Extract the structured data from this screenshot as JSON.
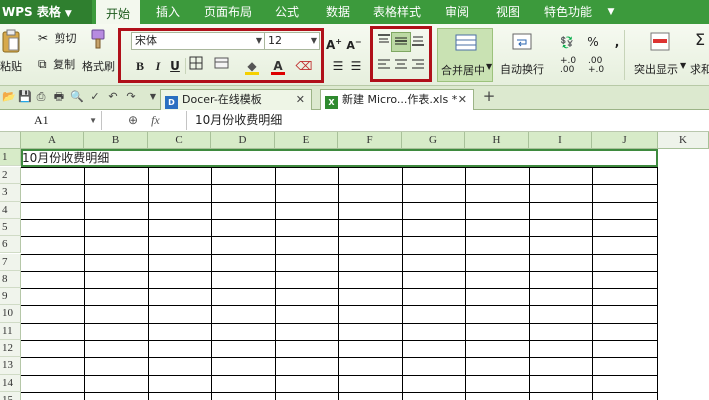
{
  "app": {
    "title": "WPS 表格"
  },
  "menu_tabs": [
    "开始",
    "插入",
    "页面布局",
    "公式",
    "数据",
    "表格样式",
    "审阅",
    "视图",
    "特色功能"
  ],
  "ribbon": {
    "paste_label": "粘贴",
    "cut_label": "剪切",
    "copy_label": "复制",
    "format_painter_label": "格式刷",
    "font_name": "宋体",
    "font_size": "12",
    "bold": "B",
    "italic": "I",
    "underline": "U",
    "merge_center_label": "合并居中",
    "wrap_text_label": "自动换行",
    "highlight_label": "突出显示",
    "sum_label": "求和",
    "percent": "%",
    "comma": ",",
    "zero_decimal_a": "+.0",
    "zero_decimal_b": ".00",
    "dec_a": ".00",
    "dec_b": "+.0"
  },
  "tabs": {
    "docer_tab": "Docer-在线模板",
    "workbook_tab": "新建 Micro...作表.xls *",
    "new_tab": "+"
  },
  "formula_bar": {
    "cell_ref": "A1",
    "fx": "fx",
    "content": "10月份收费明细"
  },
  "grid": {
    "columns": [
      "A",
      "B",
      "C",
      "D",
      "E",
      "F",
      "G",
      "H",
      "I",
      "J",
      "K"
    ],
    "rows": [
      "1",
      "2",
      "3",
      "4",
      "5",
      "6",
      "7",
      "8",
      "9",
      "10",
      "11",
      "12",
      "13",
      "14",
      "15"
    ],
    "a1_value": "10月份收费明细"
  },
  "colors": {
    "menu_green": "#3c9a3c",
    "highlight_red": "#b0101a",
    "selection_green": "#3e8a3e"
  }
}
